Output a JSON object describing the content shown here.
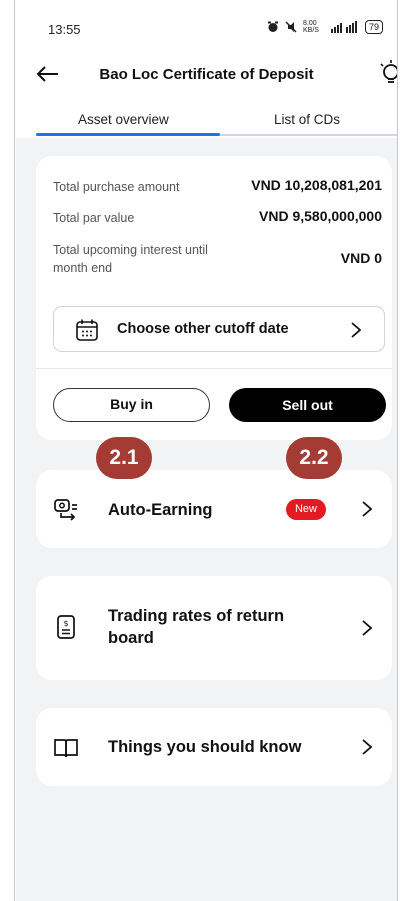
{
  "status_bar": {
    "time": "13:55",
    "icons": [
      "alarm-icon",
      "mute-icon",
      "data-speed-icon",
      "signal-icon",
      "battery-icon"
    ],
    "network_speed": "8.00 KB/S",
    "battery": "79"
  },
  "header": {
    "title": "Bao Loc Certificate of Deposit"
  },
  "tabs": [
    {
      "label": "Asset overview",
      "active": true
    },
    {
      "label": "List of CDs",
      "active": false
    }
  ],
  "summary": {
    "rows": [
      {
        "label": "Total purchase amount",
        "value": "VND 10,208,081,201"
      },
      {
        "label": "Total par value",
        "value": "VND 9,580,000,000"
      },
      {
        "label": "Total upcoming interest until month end",
        "value": "VND 0"
      }
    ],
    "cutoff_label": "Choose other cutoff date",
    "buy_label": "Buy in",
    "sell_label": "Sell out"
  },
  "annotations": {
    "buy_tag": "2.1",
    "sell_tag": "2.2"
  },
  "menu": {
    "auto_earning": {
      "label": "Auto-Earning",
      "badge": "New"
    },
    "trading_rates": {
      "label": "Trading rates of return board"
    },
    "things_to_know": {
      "label": "Things you should know"
    }
  },
  "colors": {
    "accent_tab": "#1a73e8",
    "annotation_badge": "#a43b34",
    "new_badge": "#e21b22",
    "background": "#f2f3f5"
  }
}
